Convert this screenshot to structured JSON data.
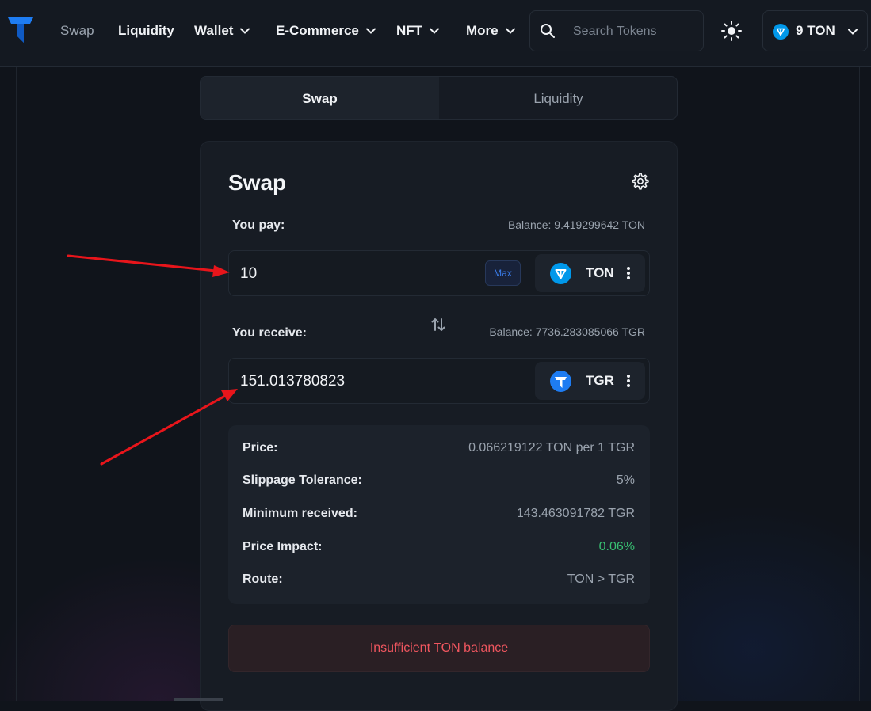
{
  "header": {
    "nav": [
      {
        "label": "Swap",
        "has_dropdown": false
      },
      {
        "label": "Liquidity",
        "has_dropdown": false
      },
      {
        "label": "Wallet",
        "has_dropdown": true
      },
      {
        "label": "E-Commerce",
        "has_dropdown": true
      },
      {
        "label": "NFT",
        "has_dropdown": true
      },
      {
        "label": "More",
        "has_dropdown": true
      }
    ],
    "search": {
      "placeholder": "Search Tokens",
      "value": ""
    },
    "wallet": {
      "label": "9 TON"
    }
  },
  "tabs": [
    {
      "label": "Swap",
      "active": true
    },
    {
      "label": "Liquidity",
      "active": false
    }
  ],
  "swap": {
    "title": "Swap",
    "pay": {
      "label": "You pay:",
      "balance": "Balance: 9.419299642 TON",
      "amount": "10",
      "max_label": "Max",
      "token": "TON"
    },
    "receive": {
      "label": "You receive:",
      "balance": "Balance: 7736.283085066 TGR",
      "amount": "151.013780823",
      "token": "TGR"
    },
    "details": [
      {
        "key": "Price:",
        "value": "0.066219122 TON per 1 TGR"
      },
      {
        "key": "Slippage Tolerance:",
        "value": "5%"
      },
      {
        "key": "Minimum received:",
        "value": "143.463091782 TGR"
      },
      {
        "key": "Price Impact:",
        "value": "0.06%"
      },
      {
        "key": "Route:",
        "value": "TON > TGR"
      }
    ],
    "error_button": "Insufficient TON balance"
  },
  "colors": {
    "background": "#10141b",
    "accent_blue": "#3b7ff0",
    "positive_green": "#38c172",
    "error_red": "#f0565f",
    "annotation_red": "#e8151b"
  }
}
